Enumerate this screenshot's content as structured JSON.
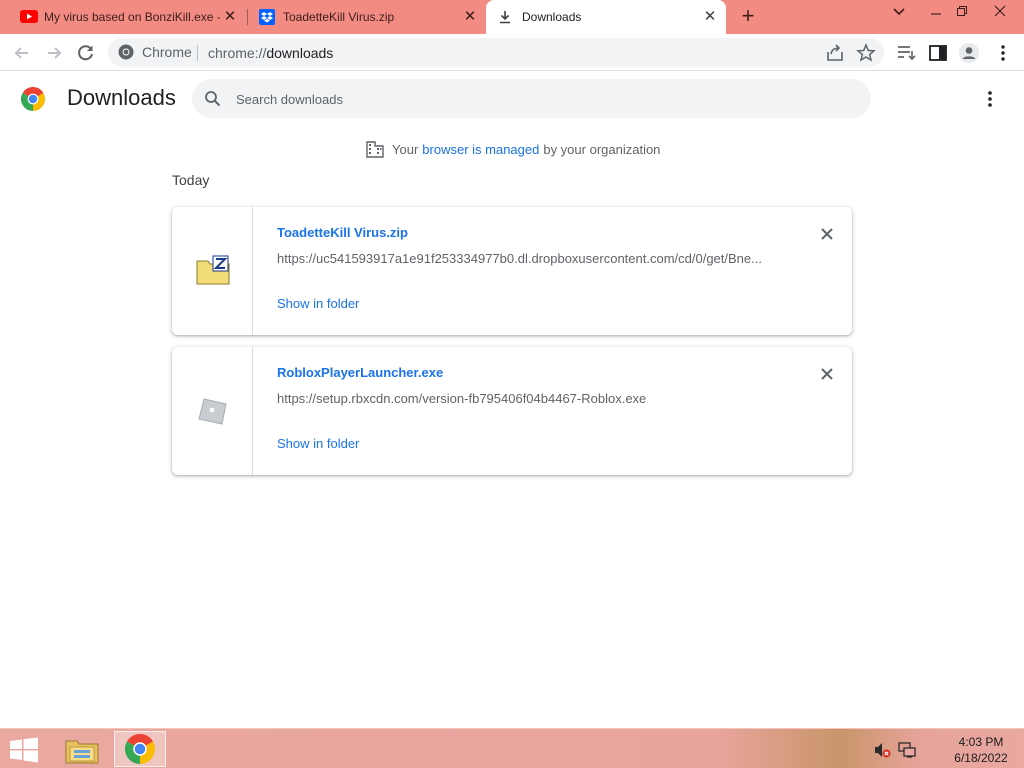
{
  "tabs": [
    {
      "title": "My virus based on BonziKill.exe -",
      "icon": "youtube-icon",
      "active": false
    },
    {
      "title": "ToadetteKill Virus.zip",
      "icon": "dropbox-icon",
      "active": false
    },
    {
      "title": "Downloads",
      "icon": "download-icon",
      "active": true
    }
  ],
  "omnibox": {
    "chip": "Chrome",
    "url_scheme": "chrome://",
    "url_host": "downloads"
  },
  "page": {
    "title": "Downloads",
    "search_placeholder": "Search downloads",
    "managed_prefix": "Your",
    "managed_link": "browser is managed",
    "managed_suffix": "by your organization",
    "date_header": "Today"
  },
  "downloads": [
    {
      "name": "ToadetteKill Virus.zip",
      "url": "https://uc541593917a1e91f253334977b0.dl.dropboxusercontent.com/cd/0/get/Bne...",
      "action": "Show in folder",
      "icon": "zip-file-icon"
    },
    {
      "name": "RobloxPlayerLauncher.exe",
      "url": "https://setup.rbxcdn.com/version-fb795406f04b4467-Roblox.exe",
      "action": "Show in folder",
      "icon": "roblox-icon"
    }
  ],
  "taskbar": {
    "time": "4:03 PM",
    "date": "6/18/2022",
    "items": [
      "file-explorer-icon",
      "chrome-icon"
    ]
  },
  "colors": {
    "tabstrip": "#f28b82",
    "link": "#1a73e8",
    "taskbar": "#e9a8a0"
  }
}
